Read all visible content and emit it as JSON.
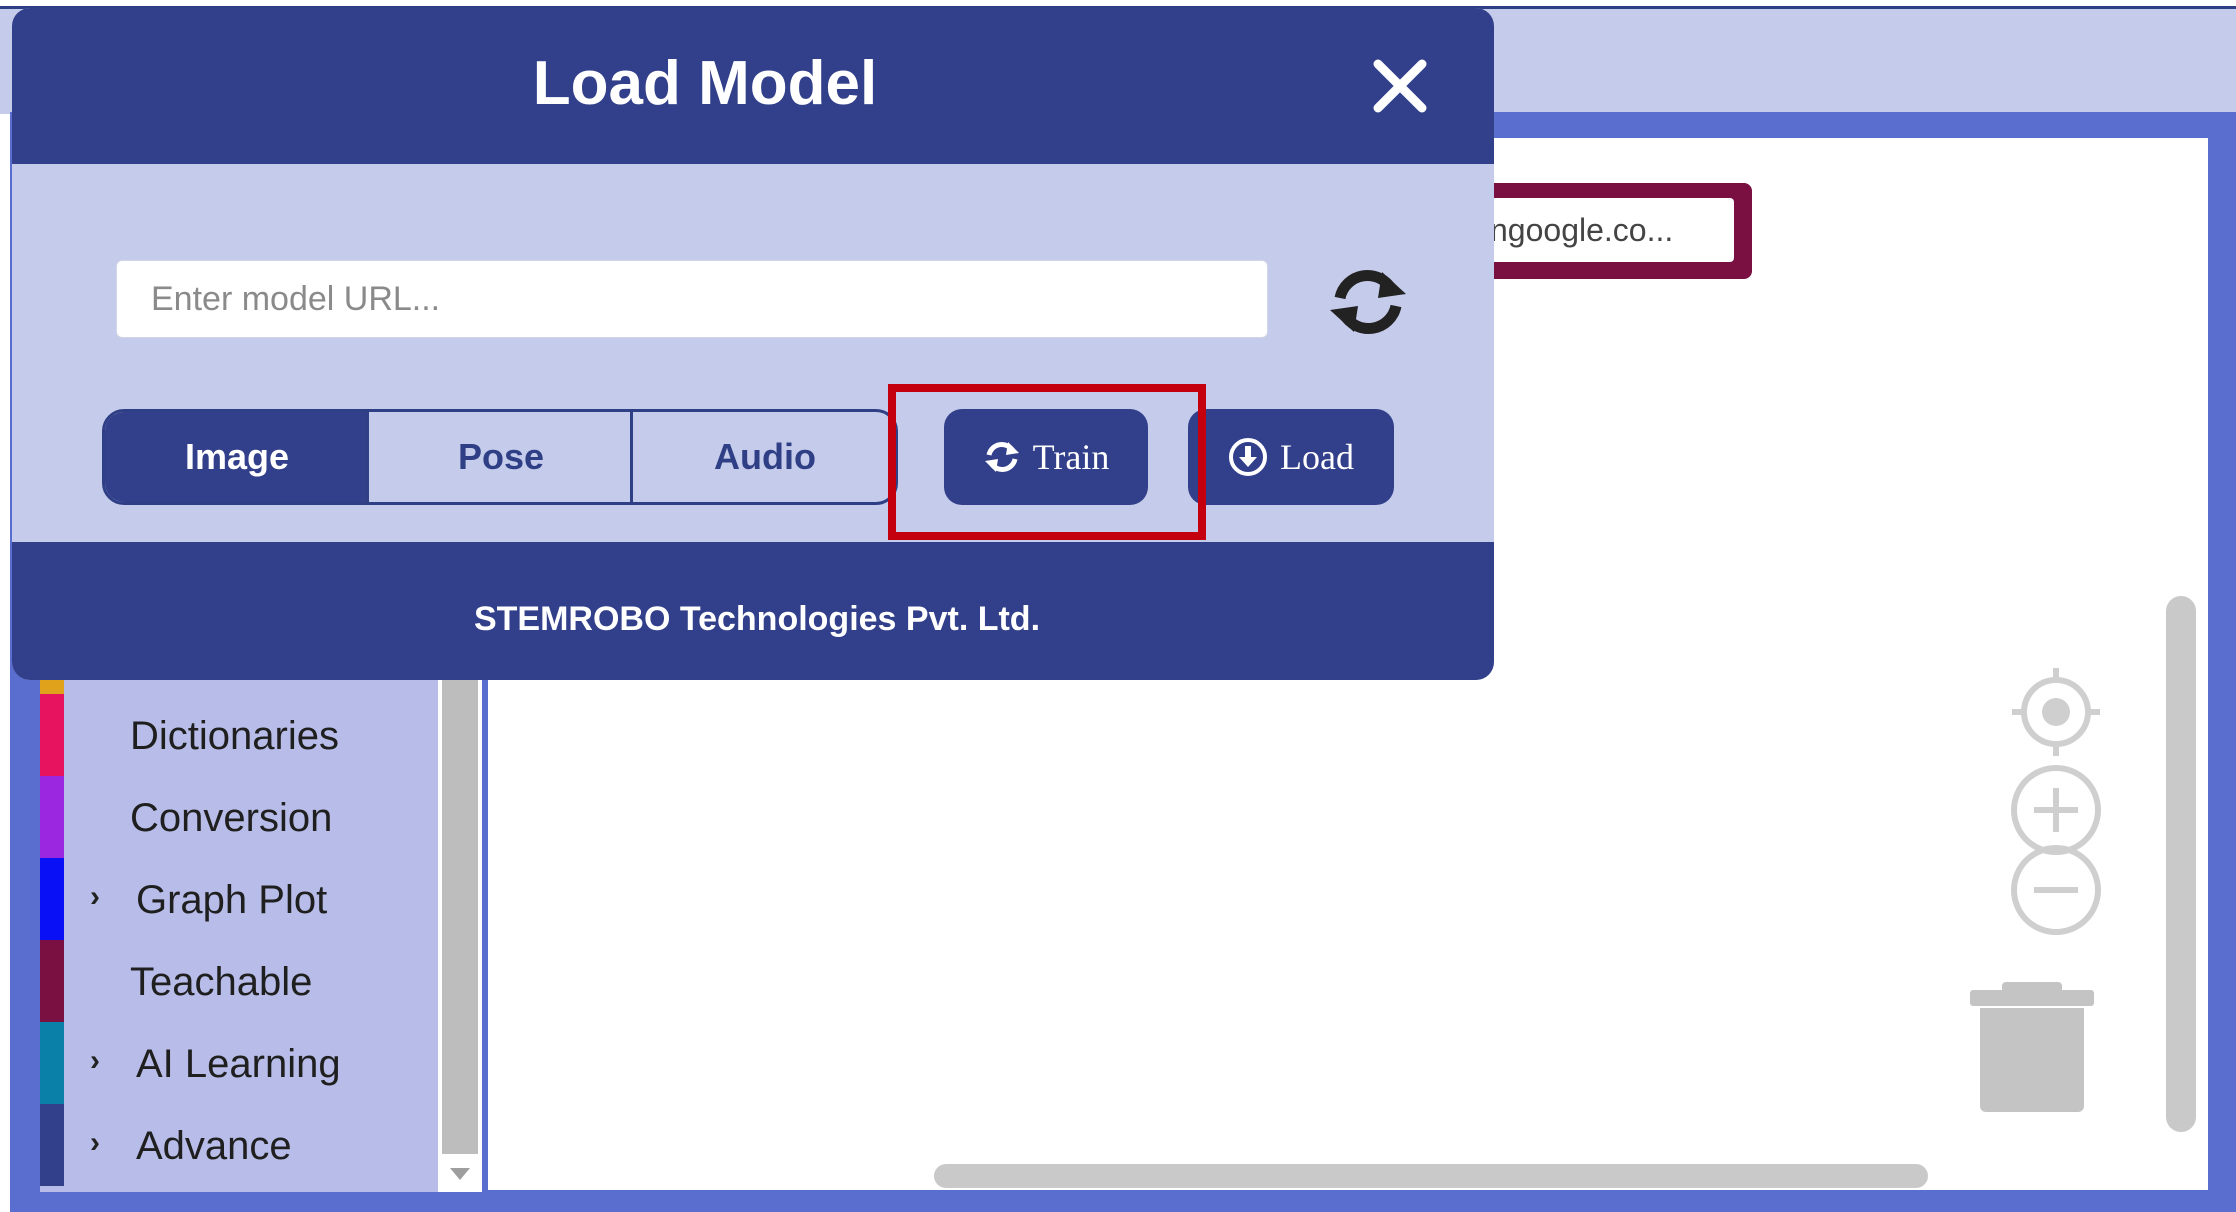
{
  "modal": {
    "title": "Load Model",
    "url_placeholder": "Enter model URL...",
    "tabs": [
      {
        "label": "Image",
        "active": true
      },
      {
        "label": "Pose",
        "active": false
      },
      {
        "label": "Audio",
        "active": false
      }
    ],
    "train_label": "Train",
    "load_label": "Load",
    "footer": "STEMROBO Technologies Pvt. Ltd."
  },
  "workspace": {
    "url_chip_text": "ngoogle.co..."
  },
  "sidebar": {
    "categories": [
      {
        "label": "Dictionaries",
        "color": "#e8135e",
        "expandable": false
      },
      {
        "label": "Conversion",
        "color": "#9b27e0",
        "expandable": false
      },
      {
        "label": "Graph Plot",
        "color": "#0a10f5",
        "expandable": true
      },
      {
        "label": "Teachable",
        "color": "#7a0f42",
        "expandable": false
      },
      {
        "label": "AI Learning",
        "color": "#0a7fa8",
        "expandable": true
      },
      {
        "label": "Advance",
        "color": "#323f8a",
        "expandable": true
      }
    ]
  },
  "icons": {
    "close": "close-icon",
    "refresh": "refresh-icon",
    "train": "sync-icon",
    "load": "download-circle-icon",
    "recenter": "crosshair-icon",
    "zoom_in": "zoom-in-icon",
    "zoom_out": "zoom-out-icon",
    "trash": "trash-icon"
  },
  "colors": {
    "primary": "#323f8a",
    "panel": "#c5cbea",
    "highlight": "#c4000f"
  }
}
